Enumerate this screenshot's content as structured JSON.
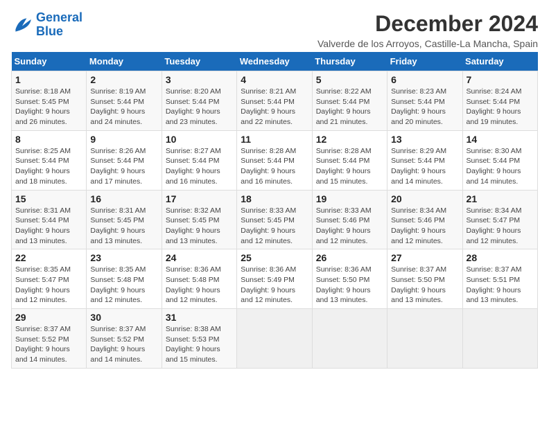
{
  "logo": {
    "line1": "General",
    "line2": "Blue"
  },
  "title": "December 2024",
  "location": "Valverde de los Arroyos, Castille-La Mancha, Spain",
  "days_header": [
    "Sunday",
    "Monday",
    "Tuesday",
    "Wednesday",
    "Thursday",
    "Friday",
    "Saturday"
  ],
  "weeks": [
    [
      {
        "day": "1",
        "sunrise": "8:18 AM",
        "sunset": "5:45 PM",
        "daylight": "9 hours and 26 minutes."
      },
      {
        "day": "2",
        "sunrise": "8:19 AM",
        "sunset": "5:44 PM",
        "daylight": "9 hours and 24 minutes."
      },
      {
        "day": "3",
        "sunrise": "8:20 AM",
        "sunset": "5:44 PM",
        "daylight": "9 hours and 23 minutes."
      },
      {
        "day": "4",
        "sunrise": "8:21 AM",
        "sunset": "5:44 PM",
        "daylight": "9 hours and 22 minutes."
      },
      {
        "day": "5",
        "sunrise": "8:22 AM",
        "sunset": "5:44 PM",
        "daylight": "9 hours and 21 minutes."
      },
      {
        "day": "6",
        "sunrise": "8:23 AM",
        "sunset": "5:44 PM",
        "daylight": "9 hours and 20 minutes."
      },
      {
        "day": "7",
        "sunrise": "8:24 AM",
        "sunset": "5:44 PM",
        "daylight": "9 hours and 19 minutes."
      }
    ],
    [
      {
        "day": "8",
        "sunrise": "8:25 AM",
        "sunset": "5:44 PM",
        "daylight": "9 hours and 18 minutes."
      },
      {
        "day": "9",
        "sunrise": "8:26 AM",
        "sunset": "5:44 PM",
        "daylight": "9 hours and 17 minutes."
      },
      {
        "day": "10",
        "sunrise": "8:27 AM",
        "sunset": "5:44 PM",
        "daylight": "9 hours and 16 minutes."
      },
      {
        "day": "11",
        "sunrise": "8:28 AM",
        "sunset": "5:44 PM",
        "daylight": "9 hours and 16 minutes."
      },
      {
        "day": "12",
        "sunrise": "8:28 AM",
        "sunset": "5:44 PM",
        "daylight": "9 hours and 15 minutes."
      },
      {
        "day": "13",
        "sunrise": "8:29 AM",
        "sunset": "5:44 PM",
        "daylight": "9 hours and 14 minutes."
      },
      {
        "day": "14",
        "sunrise": "8:30 AM",
        "sunset": "5:44 PM",
        "daylight": "9 hours and 14 minutes."
      }
    ],
    [
      {
        "day": "15",
        "sunrise": "8:31 AM",
        "sunset": "5:44 PM",
        "daylight": "9 hours and 13 minutes."
      },
      {
        "day": "16",
        "sunrise": "8:31 AM",
        "sunset": "5:45 PM",
        "daylight": "9 hours and 13 minutes."
      },
      {
        "day": "17",
        "sunrise": "8:32 AM",
        "sunset": "5:45 PM",
        "daylight": "9 hours and 13 minutes."
      },
      {
        "day": "18",
        "sunrise": "8:33 AM",
        "sunset": "5:45 PM",
        "daylight": "9 hours and 12 minutes."
      },
      {
        "day": "19",
        "sunrise": "8:33 AM",
        "sunset": "5:46 PM",
        "daylight": "9 hours and 12 minutes."
      },
      {
        "day": "20",
        "sunrise": "8:34 AM",
        "sunset": "5:46 PM",
        "daylight": "9 hours and 12 minutes."
      },
      {
        "day": "21",
        "sunrise": "8:34 AM",
        "sunset": "5:47 PM",
        "daylight": "9 hours and 12 minutes."
      }
    ],
    [
      {
        "day": "22",
        "sunrise": "8:35 AM",
        "sunset": "5:47 PM",
        "daylight": "9 hours and 12 minutes."
      },
      {
        "day": "23",
        "sunrise": "8:35 AM",
        "sunset": "5:48 PM",
        "daylight": "9 hours and 12 minutes."
      },
      {
        "day": "24",
        "sunrise": "8:36 AM",
        "sunset": "5:48 PM",
        "daylight": "9 hours and 12 minutes."
      },
      {
        "day": "25",
        "sunrise": "8:36 AM",
        "sunset": "5:49 PM",
        "daylight": "9 hours and 12 minutes."
      },
      {
        "day": "26",
        "sunrise": "8:36 AM",
        "sunset": "5:50 PM",
        "daylight": "9 hours and 13 minutes."
      },
      {
        "day": "27",
        "sunrise": "8:37 AM",
        "sunset": "5:50 PM",
        "daylight": "9 hours and 13 minutes."
      },
      {
        "day": "28",
        "sunrise": "8:37 AM",
        "sunset": "5:51 PM",
        "daylight": "9 hours and 13 minutes."
      }
    ],
    [
      {
        "day": "29",
        "sunrise": "8:37 AM",
        "sunset": "5:52 PM",
        "daylight": "9 hours and 14 minutes."
      },
      {
        "day": "30",
        "sunrise": "8:37 AM",
        "sunset": "5:52 PM",
        "daylight": "9 hours and 14 minutes."
      },
      {
        "day": "31",
        "sunrise": "8:38 AM",
        "sunset": "5:53 PM",
        "daylight": "9 hours and 15 minutes."
      },
      null,
      null,
      null,
      null
    ]
  ]
}
